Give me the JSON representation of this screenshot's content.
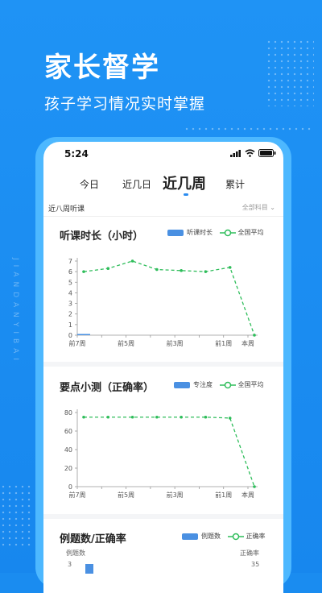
{
  "hero": {
    "title": "家长督学",
    "subtitle": "孩子学习情况实时掌握",
    "side_text": "JIANDANYIBAI"
  },
  "status": {
    "time": "5:24"
  },
  "tabs": [
    {
      "label": "今日"
    },
    {
      "label": "近几日"
    },
    {
      "label": "近几周"
    },
    {
      "label": "累计"
    }
  ],
  "filter": {
    "left": "近八周听课",
    "right": "全部科目"
  },
  "colors": {
    "primary": "#1f8ff2",
    "bar": "#4a90e2",
    "avg_line": "#2ebd5a"
  },
  "chart1": {
    "title": "听课时长（小时）",
    "legend_a": "听课时长",
    "legend_b": "全国平均"
  },
  "chart2": {
    "title": "要点小测（正确率）",
    "legend_a": "专注度",
    "legend_b": "全国平均"
  },
  "chart3": {
    "title": "例题数/正确率",
    "legend_a": "例题数",
    "legend_b": "正确率",
    "ylabel_left": "例题数",
    "ylabel_right": "正确率",
    "tick_left": "3",
    "tick_right": "35"
  },
  "chart_data": [
    {
      "type": "line",
      "title": "听课时长（小时）",
      "x_ticks": [
        "前7周",
        "前5周",
        "前3周",
        "前1周",
        "本周"
      ],
      "y_ticks": [
        "0",
        "1",
        "2",
        "3",
        "4",
        "5",
        "6",
        "7"
      ],
      "ylim": [
        0,
        7
      ],
      "series": [
        {
          "name": "听课时长",
          "type": "bar",
          "values": [
            0.1,
            0,
            0,
            0,
            0,
            0,
            0,
            0
          ]
        },
        {
          "name": "全国平均",
          "type": "line",
          "values": [
            6,
            6.3,
            7,
            6.2,
            6.1,
            6,
            6.4,
            0
          ]
        }
      ]
    },
    {
      "type": "line",
      "title": "要点小测（正确率）",
      "x_ticks": [
        "前7周",
        "前5周",
        "前3周",
        "前1周",
        "本周"
      ],
      "y_ticks": [
        "0",
        "20",
        "40",
        "60",
        "80"
      ],
      "ylim": [
        0,
        80
      ],
      "series": [
        {
          "name": "专注度",
          "type": "bar",
          "values": [
            0,
            0,
            0,
            0,
            0,
            0,
            0,
            0
          ]
        },
        {
          "name": "全国平均",
          "type": "line",
          "values": [
            75,
            75,
            75,
            75,
            75,
            75,
            74,
            0
          ]
        }
      ]
    }
  ]
}
